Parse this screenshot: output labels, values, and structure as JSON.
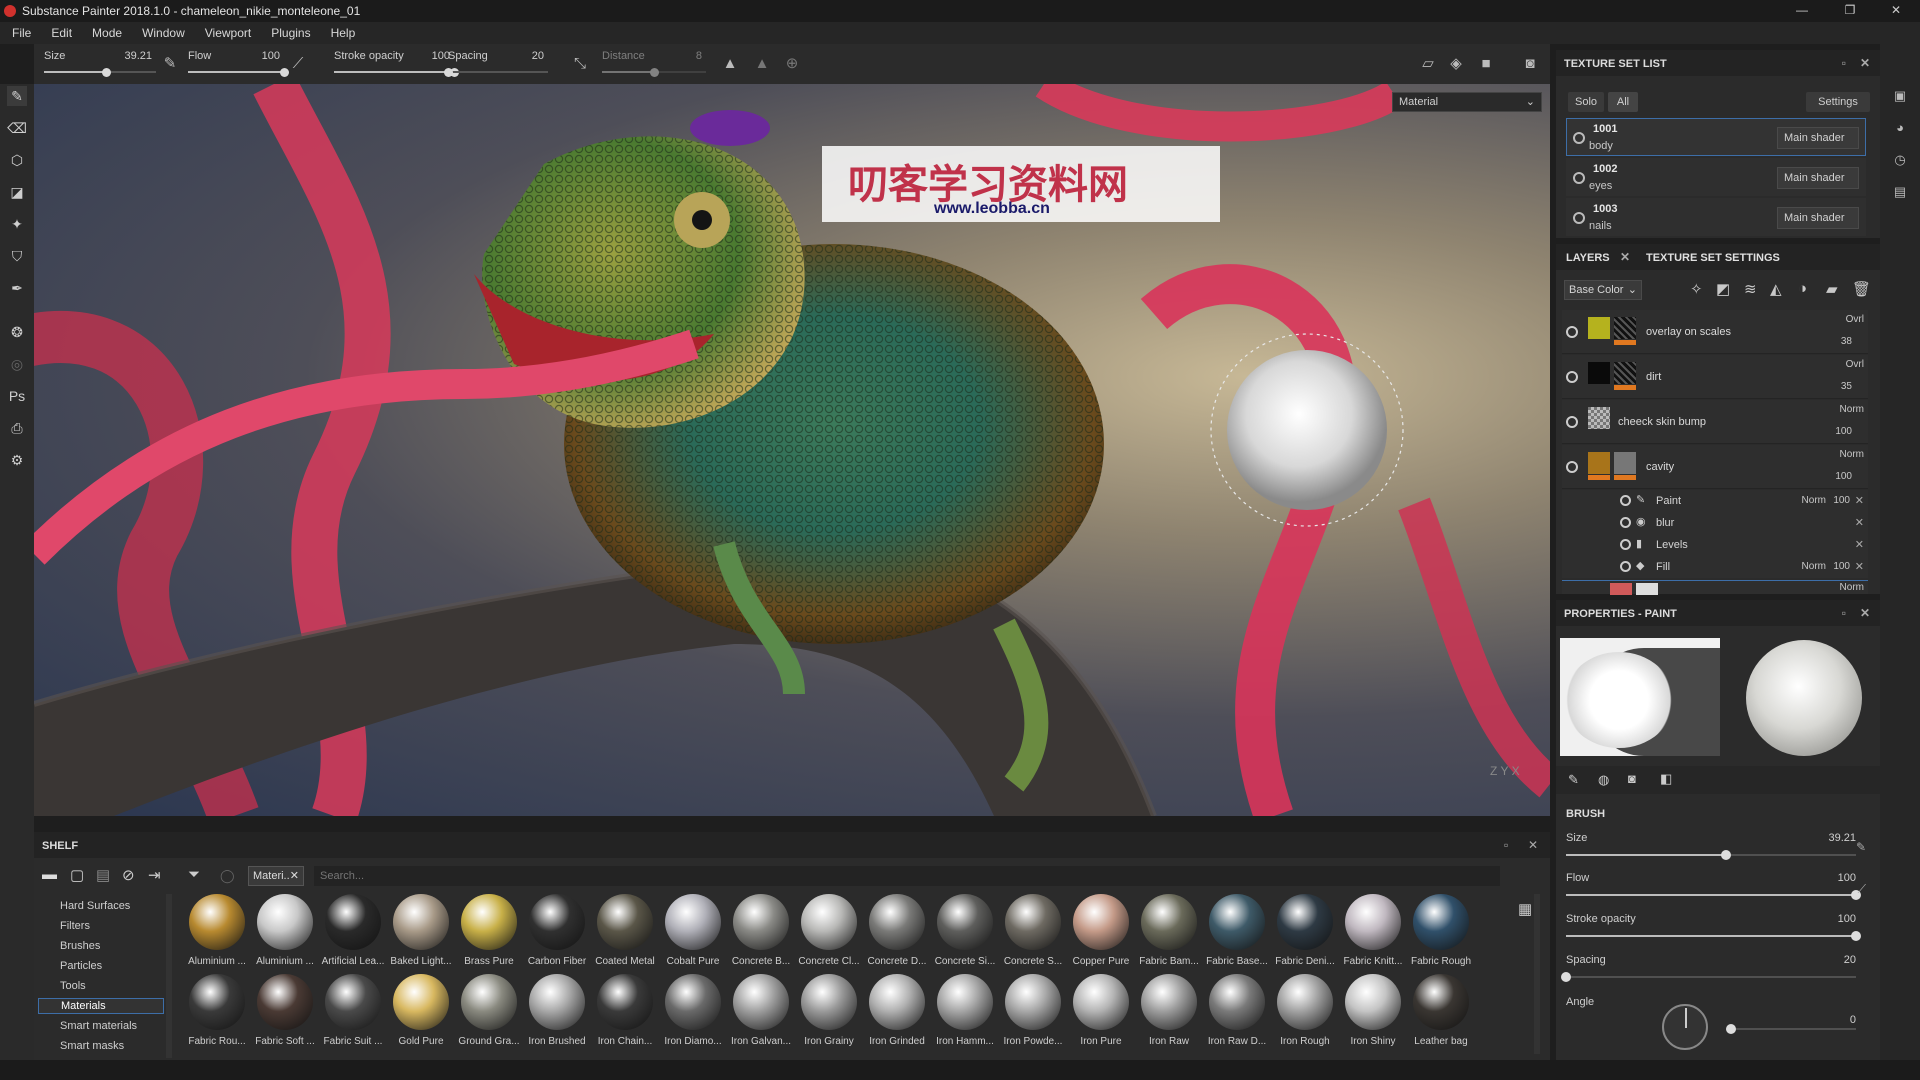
{
  "window": {
    "title": "Substance Painter 2018.1.0 - chameleon_nikie_monteleone_01",
    "minimize": "—",
    "maximize": "❐",
    "close": "✕"
  },
  "menu": [
    "File",
    "Edit",
    "Mode",
    "Window",
    "Viewport",
    "Plugins",
    "Help"
  ],
  "toolbar": {
    "size": {
      "label": "Size",
      "value": "39.21",
      "fraction": 0.55
    },
    "flow": {
      "label": "Flow",
      "value": "100",
      "fraction": 1.0
    },
    "stroke_opacity": {
      "label": "Stroke opacity",
      "value": "100",
      "fraction": 1.0
    },
    "spacing": {
      "label": "Spacing",
      "value": "20",
      "fraction": 0.0
    },
    "distance": {
      "label": "Distance",
      "value": "8",
      "fraction": 0.5
    }
  },
  "viewport": {
    "mode_select": "Material",
    "watermark_cn": "叨客学习资料网",
    "watermark_url": "www.leobba.cn",
    "axis": "Z  Y  X"
  },
  "texture_set_list": {
    "title": "TEXTURE SET LIST",
    "solo": "Solo",
    "all": "All",
    "settings": "Settings",
    "sets": [
      {
        "id": "1001",
        "name": "body",
        "shader": "Main shader"
      },
      {
        "id": "1002",
        "name": "eyes",
        "shader": "Main shader"
      },
      {
        "id": "1003",
        "name": "nails",
        "shader": "Main shader"
      }
    ]
  },
  "layers": {
    "tab_layers": "LAYERS",
    "tab_tss": "TEXTURE SET SETTINGS",
    "channel": "Base Color",
    "items": [
      {
        "name": "overlay on scales",
        "blend": "Ovrl",
        "opacity": "38",
        "color": "#b5b21e"
      },
      {
        "name": "dirt",
        "blend": "Ovrl",
        "opacity": "35",
        "color": "#0a0a0a"
      },
      {
        "name": "cheeck skin bump",
        "blend": "Norm",
        "opacity": "100",
        "color": "#888888"
      },
      {
        "name": "cavity",
        "blend": "Norm",
        "opacity": "100",
        "color": "#a8741a"
      }
    ],
    "sub_items": [
      {
        "name": "Paint",
        "icon": "✎",
        "blend": "Norm",
        "opacity": "100"
      },
      {
        "name": "blur",
        "icon": "◉",
        "blend": "",
        "opacity": ""
      },
      {
        "name": "Levels",
        "icon": "▮",
        "blend": "",
        "opacity": ""
      },
      {
        "name": "Fill",
        "icon": "◆",
        "blend": "Norm",
        "opacity": "100"
      }
    ],
    "last_row_blend": "Norm"
  },
  "properties": {
    "title": "PROPERTIES - PAINT",
    "section": "BRUSH",
    "size": {
      "label": "Size",
      "value": "39.21",
      "fraction": 0.55
    },
    "flow": {
      "label": "Flow",
      "value": "100",
      "fraction": 1.0
    },
    "stroke_opacity": {
      "label": "Stroke opacity",
      "value": "100",
      "fraction": 1.0
    },
    "spacing": {
      "label": "Spacing",
      "value": "20",
      "fraction": 0.0
    },
    "angle": {
      "label": "Angle",
      "value": "0",
      "fraction": 0.0
    }
  },
  "shelf": {
    "title": "SHELF",
    "filter_tag": "Materi..",
    "search_placeholder": "Search...",
    "categories": [
      "Hard Surfaces",
      "Filters",
      "Brushes",
      "Particles",
      "Tools",
      "Materials",
      "Smart materials",
      "Smart masks"
    ],
    "selected_category": "Materials",
    "materials": [
      {
        "name": "Aluminium ...",
        "color": "#b88a30"
      },
      {
        "name": "Aluminium ...",
        "color": "#c8c8c8"
      },
      {
        "name": "Artificial Lea...",
        "color": "#2a2a2a"
      },
      {
        "name": "Baked Light...",
        "color": "#a89a88"
      },
      {
        "name": "Brass Pure",
        "color": "#c8b048"
      },
      {
        "name": "Carbon Fiber",
        "color": "#303030"
      },
      {
        "name": "Coated Metal",
        "color": "#5a5648"
      },
      {
        "name": "Cobalt Pure",
        "color": "#b0b0b8"
      },
      {
        "name": "Concrete B...",
        "color": "#8a8a86"
      },
      {
        "name": "Concrete Cl...",
        "color": "#b8b8b6"
      },
      {
        "name": "Concrete D...",
        "color": "#7a7a78"
      },
      {
        "name": "Concrete Si...",
        "color": "#5e5e5c"
      },
      {
        "name": "Concrete S...",
        "color": "#6e6a62"
      },
      {
        "name": "Copper Pure",
        "color": "#c49a88"
      },
      {
        "name": "Fabric Bam...",
        "color": "#6a6a5a"
      },
      {
        "name": "Fabric Base...",
        "color": "#3e5a68"
      },
      {
        "name": "Fabric Deni...",
        "color": "#2e3a44"
      },
      {
        "name": "Fabric Knitt...",
        "color": "#c0b8c0"
      },
      {
        "name": "Fabric Rough",
        "color": "#30506a"
      },
      {
        "name": "Fabric Rou...",
        "color": "#3a3a3a"
      },
      {
        "name": "Fabric Soft ...",
        "color": "#4a3a34"
      },
      {
        "name": "Fabric Suit ...",
        "color": "#4a4a4a"
      },
      {
        "name": "Gold Pure",
        "color": "#d8b860"
      },
      {
        "name": "Ground Gra...",
        "color": "#8a8a80"
      },
      {
        "name": "Iron Brushed",
        "color": "#a8a8a8"
      },
      {
        "name": "Iron Chain...",
        "color": "#3a3a3a"
      },
      {
        "name": "Iron Diamo...",
        "color": "#6a6a6a"
      },
      {
        "name": "Iron Galvan...",
        "color": "#a0a0a0"
      },
      {
        "name": "Iron Grainy",
        "color": "#9a9a9a"
      },
      {
        "name": "Iron Grinded",
        "color": "#b0b0b0"
      },
      {
        "name": "Iron Hamm...",
        "color": "#a6a6a6"
      },
      {
        "name": "Iron Powde...",
        "color": "#a8a8a8"
      },
      {
        "name": "Iron Pure",
        "color": "#b4b4b4"
      },
      {
        "name": "Iron Raw",
        "color": "#9e9e9e"
      },
      {
        "name": "Iron Raw D...",
        "color": "#7a7a7a"
      },
      {
        "name": "Iron Rough",
        "color": "#a2a2a2"
      },
      {
        "name": "Iron Shiny",
        "color": "#c4c4c4"
      },
      {
        "name": "Leather bag",
        "color": "#3a3632"
      }
    ]
  }
}
